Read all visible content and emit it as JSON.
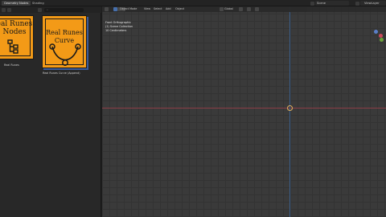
{
  "topbar": {
    "tabs": [
      "Geometry Nodes",
      "Shading"
    ],
    "active_tab_index": 0,
    "scene_label": "Scene",
    "view_layer_label": "ViewLayer"
  },
  "asset_browser": {
    "search_placeholder": "",
    "items": [
      {
        "title_line1": "eal Runes",
        "title_line2": "Nodes",
        "label": "Real Runes"
      },
      {
        "title_line1": "Real Runes",
        "title_line2": "Curve",
        "label": "Real Runes Curve (Append)"
      }
    ]
  },
  "viewport": {
    "mode": "Object Mode",
    "menus": [
      "View",
      "Select",
      "Add",
      "Object"
    ],
    "transform": "Global",
    "overlay_lines": [
      "Front Orthographic",
      "(1) Scene Collection",
      "10 Centimeters"
    ]
  },
  "colors": {
    "thumb_orange": "#f39a17",
    "x_axis": "#8a3d46",
    "y_axis": "#3b5f8c",
    "accent_blue": "#4772b3"
  }
}
